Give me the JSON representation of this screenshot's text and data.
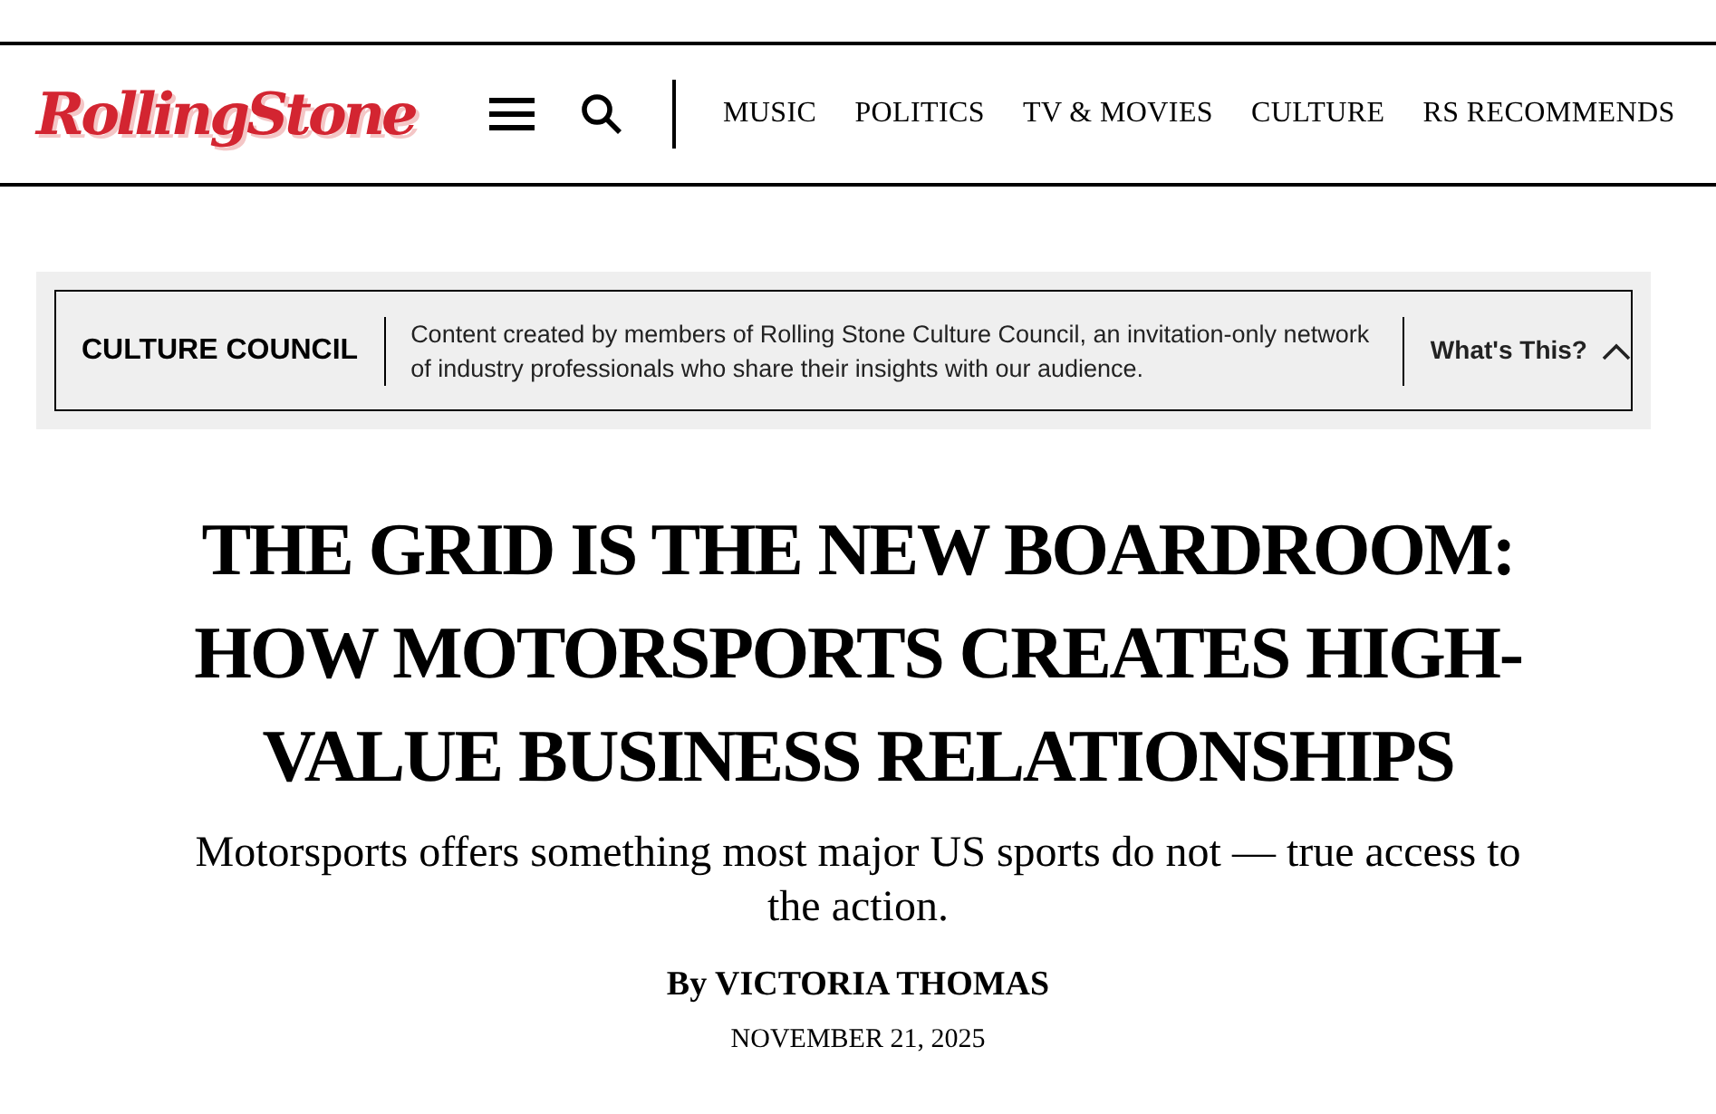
{
  "header": {
    "logo": "RollingStone",
    "nav": [
      "MUSIC",
      "POLITICS",
      "TV & MOVIES",
      "CULTURE",
      "RS RECOMMENDS"
    ]
  },
  "council": {
    "label": "CULTURE COUNCIL",
    "text": "Content created by members of Rolling Stone Culture Council, an invitation-only network of industry professionals who share their insights with our audience.",
    "toggle": "What's This?",
    "expanded": true
  },
  "article": {
    "headline": "THE GRID IS THE NEW BOARDROOM: HOW MOTORSPORTS CREATES HIGH-VALUE BUSINESS RELATIONSHIPS",
    "subtitle": "Motorsports offers something most major US sports do not — true access to the action.",
    "byline": "By VICTORIA THOMAS",
    "date": "NOVEMBER 21, 2025"
  }
}
